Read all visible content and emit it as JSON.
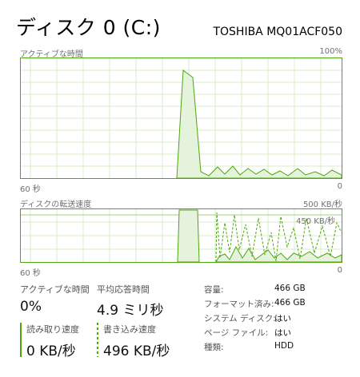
{
  "header": {
    "title": "ディスク 0 (C:)",
    "model": "TOSHIBA MQ01ACF050"
  },
  "active_chart": {
    "label": "アクティブな時間",
    "max_label": "100%",
    "duration_label": "60 秒",
    "min_label": "0",
    "color": "#4da60c"
  },
  "transfer_chart": {
    "label": "ディスクの転送速度",
    "max_label": "500 KB/秒",
    "marker_label": "450 KB/秒",
    "duration_label": "60 秒",
    "min_label": "0",
    "color": "#4da60c"
  },
  "stats": {
    "active_time": {
      "label": "アクティブな時間",
      "value": "0%"
    },
    "avg_response": {
      "label": "平均応答時間",
      "value": "4.9 ミリ秒"
    },
    "read_speed": {
      "label": "読み取り速度",
      "value": "0 KB/秒"
    },
    "write_speed": {
      "label": "書き込み速度",
      "value": "496 KB/秒"
    }
  },
  "properties": [
    {
      "label": "容量:",
      "value": "466 GB"
    },
    {
      "label": "フォーマット済み:",
      "value": "466 GB"
    },
    {
      "label": "システム ディスク:",
      "value": "はい"
    },
    {
      "label": "ページ ファイル:",
      "value": "はい"
    },
    {
      "label": "種類:",
      "value": "HDD"
    }
  ]
}
